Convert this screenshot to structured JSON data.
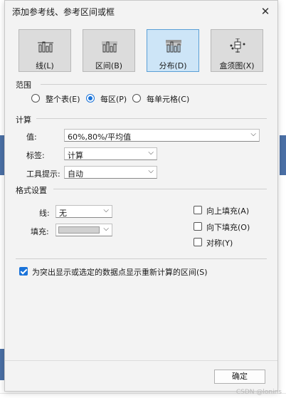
{
  "dialog": {
    "title": "添加参考线、参考区间或框",
    "close_glyph": "✕"
  },
  "type_buttons": [
    {
      "label": "线(L)",
      "icon": "line-chart-icon",
      "selected": false
    },
    {
      "label": "区间(B)",
      "icon": "band-chart-icon",
      "selected": false
    },
    {
      "label": "分布(D)",
      "icon": "distribution-chart-icon",
      "selected": true
    },
    {
      "label": "盒须图(X)",
      "icon": "box-whisker-icon",
      "selected": false
    }
  ],
  "scope": {
    "heading": "范围",
    "options": [
      {
        "label": "整个表(E)",
        "selected": false
      },
      {
        "label": "每区(P)",
        "selected": true
      },
      {
        "label": "每单元格(C)",
        "selected": false
      }
    ]
  },
  "compute": {
    "heading": "计算",
    "value_label": "值:",
    "value": "60%,80%/平均值",
    "label_label": "标签:",
    "label_value": "计算",
    "tooltip_label": "工具提示:",
    "tooltip_value": "自动"
  },
  "format": {
    "heading": "格式设置",
    "line_label": "线:",
    "line_value": "无",
    "fill_label": "填充:",
    "fill_up": "向上填充(A)",
    "fill_down": "向下填充(O)",
    "symmetric": "对称(Y)"
  },
  "highlight_option": "为突出显示或选定的数据点显示重新计算的区间(S)",
  "ok_label": "确定",
  "watermark": "CSDN @lonins",
  "colors": {
    "accent": "#1a73d9",
    "selected_bg": "#cde5f7",
    "dialog_bg": "#f3f3f3"
  }
}
